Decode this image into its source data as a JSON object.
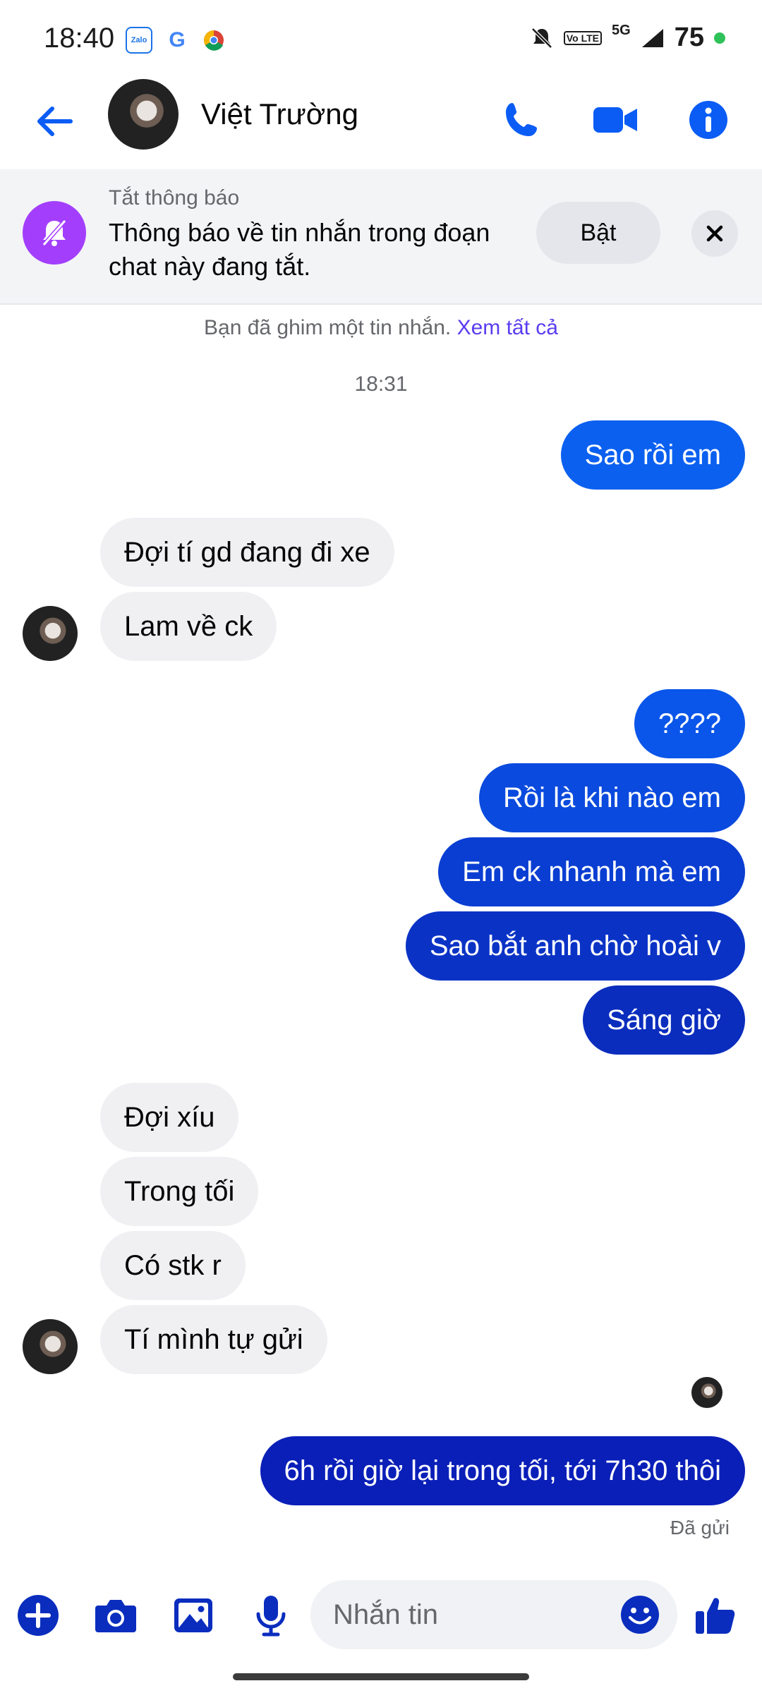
{
  "status_bar": {
    "time": "18:40",
    "apps": [
      "Zalo",
      "G",
      "Chrome"
    ],
    "network": "5G",
    "volte": "Vo LTE",
    "battery": "75"
  },
  "header": {
    "contact_name": "Việt Trường",
    "icons": [
      "back-arrow-icon",
      "phone-icon",
      "video-camera-icon",
      "info-icon"
    ]
  },
  "notice": {
    "title": "Tắt thông báo",
    "text": "Thông báo về tin nhắn trong đoạn chat này đang tắt.",
    "button": "Bật"
  },
  "pinned": {
    "text": "Bạn đã ghim một tin nhắn.",
    "link": "Xem tất cả"
  },
  "timestamp": "18:31",
  "messages": [
    {
      "from": "me",
      "text": "Sao rồi em"
    },
    {
      "from": "them",
      "text": "Đợi tí gd đang đi xe"
    },
    {
      "from": "them",
      "text": "Lam về ck"
    },
    {
      "from": "me",
      "text": "????"
    },
    {
      "from": "me",
      "text": "Rồi là khi nào em"
    },
    {
      "from": "me",
      "text": "Em ck nhanh mà em"
    },
    {
      "from": "me",
      "text": "Sao bắt anh chờ hoài v"
    },
    {
      "from": "me",
      "text": "Sáng giờ"
    },
    {
      "from": "them",
      "text": "Đợi xíu"
    },
    {
      "from": "them",
      "text": "Trong tối"
    },
    {
      "from": "them",
      "text": "Có stk r"
    },
    {
      "from": "them",
      "text": "Tí mình tự gửi"
    },
    {
      "from": "me",
      "text": "6h rồi giờ lại trong tối, tới 7h30 thôi"
    }
  ],
  "sent_status": "Đã gửi",
  "composer": {
    "placeholder": "Nhắn tin",
    "icons": [
      "plus-icon",
      "camera-icon",
      "gallery-icon",
      "microphone-icon",
      "emoji-icon",
      "thumbs-up-icon"
    ]
  },
  "colors": {
    "accent": "#0a5cf5",
    "outgoing_top": "#0b60f0",
    "outgoing_bottom": "#0a1fb8",
    "incoming": "#f0f0f3",
    "mute_purple": "#a33ffc"
  }
}
